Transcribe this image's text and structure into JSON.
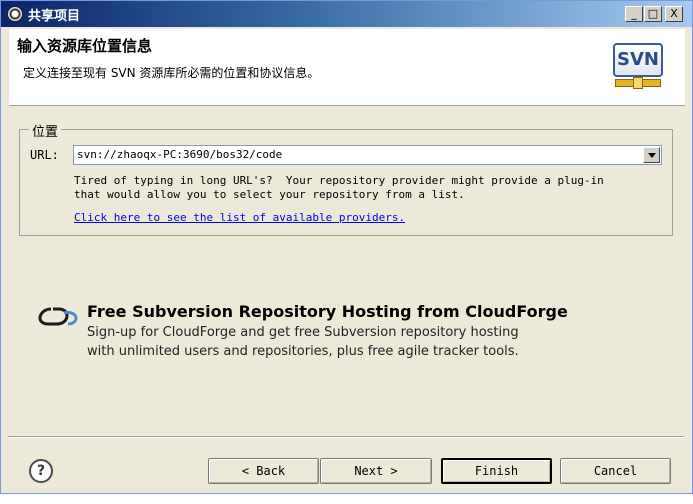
{
  "window": {
    "title": "共享项目"
  },
  "titlebar_buttons": {
    "minimize": "_",
    "maximize": "□",
    "close": "X"
  },
  "header": {
    "title": "输入资源库位置信息",
    "description": "定义连接至现有 SVN 资源库所必需的位置和协议信息。",
    "logo_text": "SVN"
  },
  "location": {
    "group_label": "位置",
    "url_label": "URL:",
    "url_value": "svn://zhaoqx-PC:3690/bos32/code",
    "help_text": "Tired of typing in long URL's?  Your repository provider might provide a plug-in\nthat would allow you to select your repository from a list.",
    "providers_link": "Click here to see the list of available providers."
  },
  "cloudforge": {
    "title": "Free Subversion Repository Hosting from CloudForge",
    "line1": "Sign-up for CloudForge and get free Subversion repository hosting",
    "line2": "with unlimited users and repositories, plus free agile tracker tools."
  },
  "footer": {
    "help": "?",
    "back": "< Back",
    "next": "Next >",
    "finish": "Finish",
    "cancel": "Cancel"
  }
}
